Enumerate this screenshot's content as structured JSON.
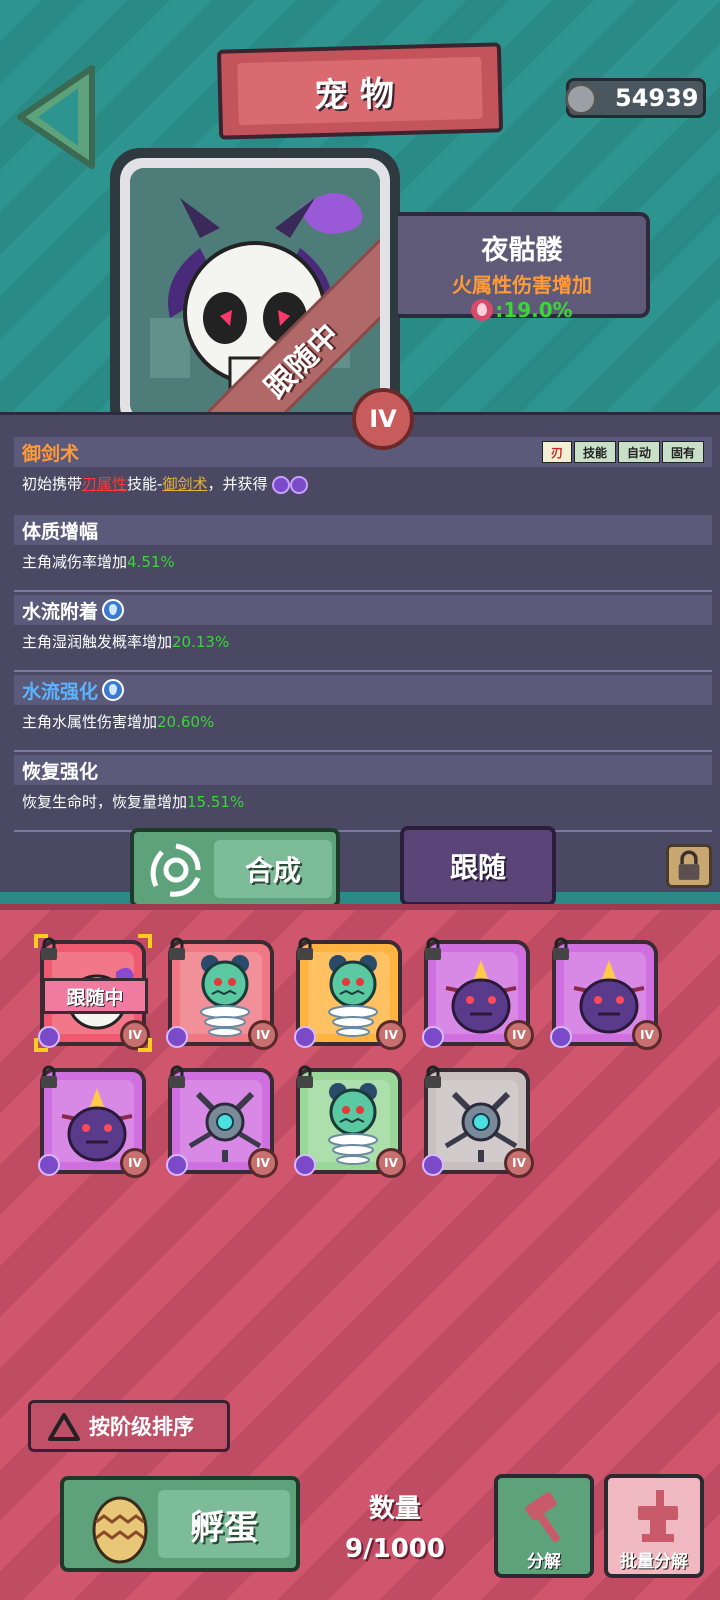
{
  "header": {
    "title": "宠物",
    "currency": "54939"
  },
  "pet": {
    "status": "跟随中",
    "tier": "IV",
    "name": "夜骷髅",
    "effect": "火属性伤害增加",
    "effect_value": ":19.0%"
  },
  "skills": [
    {
      "title": "御剑术",
      "tags": [
        "刃",
        "技能",
        "自动",
        "固有"
      ],
      "desc_prefix": "初始携带",
      "desc_attr": "刃属性",
      "desc_mid": "技能-",
      "desc_skill": "御剑术",
      "desc_suffix": "，并获得"
    },
    {
      "title": "体质增幅",
      "desc": "主角减伤率增加",
      "value": "4.51%"
    },
    {
      "title": "水流附着",
      "desc": "主角湿润触发概率增加",
      "value": "20.13%"
    },
    {
      "title": "水流强化",
      "desc": "主角水属性伤害增加",
      "value": "20.60%"
    },
    {
      "title": "恢复强化",
      "desc": "恢复生命时，恢复量增加",
      "value": "15.51%"
    }
  ],
  "actions": {
    "merge": "合成",
    "follow": "跟随"
  },
  "inventory": {
    "follow_tag": "跟随中",
    "cards": [
      {
        "color": "red",
        "monster": "skull",
        "tier": "IV",
        "following": true,
        "selected": true
      },
      {
        "color": "pink",
        "monster": "spring",
        "tier": "IV"
      },
      {
        "color": "orange",
        "monster": "spring",
        "tier": "IV"
      },
      {
        "color": "purple",
        "monster": "horn",
        "tier": "IV"
      },
      {
        "color": "purple",
        "monster": "horn",
        "tier": "IV"
      },
      {
        "color": "purple",
        "monster": "horn",
        "tier": "IV"
      },
      {
        "color": "purple",
        "monster": "robot",
        "tier": "IV"
      },
      {
        "color": "green",
        "monster": "spring",
        "tier": "IV"
      },
      {
        "color": "grey",
        "monster": "robot",
        "tier": "IV"
      }
    ]
  },
  "footer": {
    "sort_label": "按阶级排序",
    "hatch_label": "孵蛋",
    "count_label": "数量",
    "count_value": "9/1000",
    "decompose_label": "分解",
    "batch_decompose_label": "批量分解"
  }
}
